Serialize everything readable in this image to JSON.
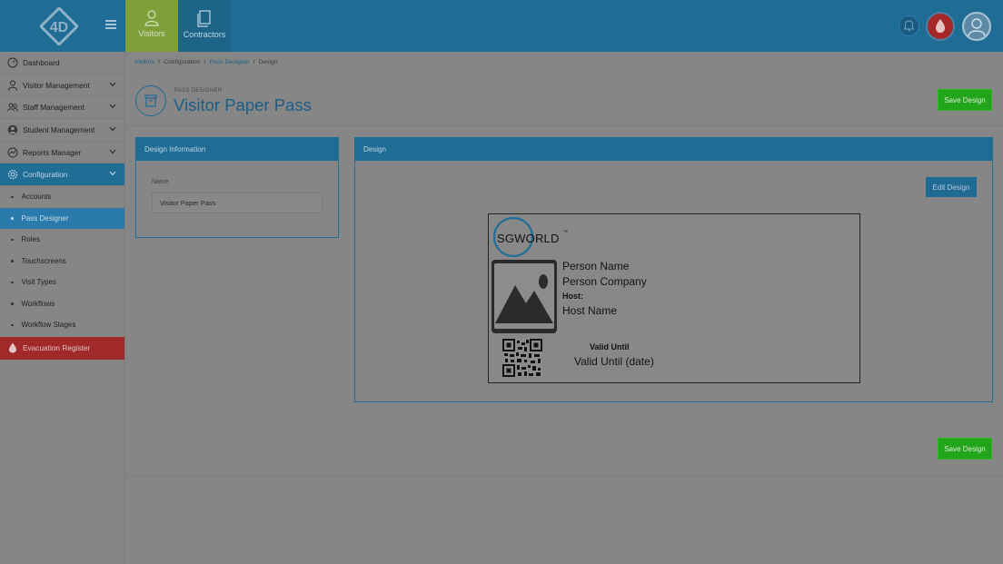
{
  "topbar": {
    "tabs": [
      {
        "label": "Visitors"
      },
      {
        "label": "Contractors"
      }
    ]
  },
  "sidebar": {
    "items": [
      {
        "label": "Dashboard"
      },
      {
        "label": "Visitor Management"
      },
      {
        "label": "Staff Management"
      },
      {
        "label": "Student Management"
      },
      {
        "label": "Reports Manager"
      },
      {
        "label": "Configuration"
      }
    ],
    "subitems": [
      {
        "label": "Accounts"
      },
      {
        "label": "Pass Designer"
      },
      {
        "label": "Roles"
      },
      {
        "label": "Touchscreens"
      },
      {
        "label": "Visit Types"
      },
      {
        "label": "Workflows"
      },
      {
        "label": "Workflow Stages"
      }
    ],
    "evacuation": "Evacuation Register"
  },
  "breadcrumb": {
    "items": [
      "Visitors",
      "Configuration",
      "Pass Designer",
      "Design"
    ],
    "separator": "/"
  },
  "header": {
    "eyebrow": "PASS DESIGNER",
    "title": "Visitor Paper Pass",
    "save_label": "Save Design"
  },
  "design_info": {
    "heading": "Design Information",
    "name_label": "Name",
    "name_value": "Visitor Paper Pass"
  },
  "design": {
    "heading": "Design",
    "edit_label": "Edit Design",
    "card": {
      "logo_text": "SGWORLD",
      "logo_mark": "™",
      "person_name": "Person Name",
      "person_company": "Person Company",
      "host_label": "Host:",
      "host_name": "Host Name",
      "valid_label": "Valid Until",
      "valid_value": "Valid Until (date)"
    }
  },
  "footer": {
    "save_label": "Save Design"
  },
  "colors": {
    "primary": "#1f6c95",
    "success": "#23a51b",
    "danger": "#a22929",
    "active_visitor_tab": "#7f9f3b"
  }
}
